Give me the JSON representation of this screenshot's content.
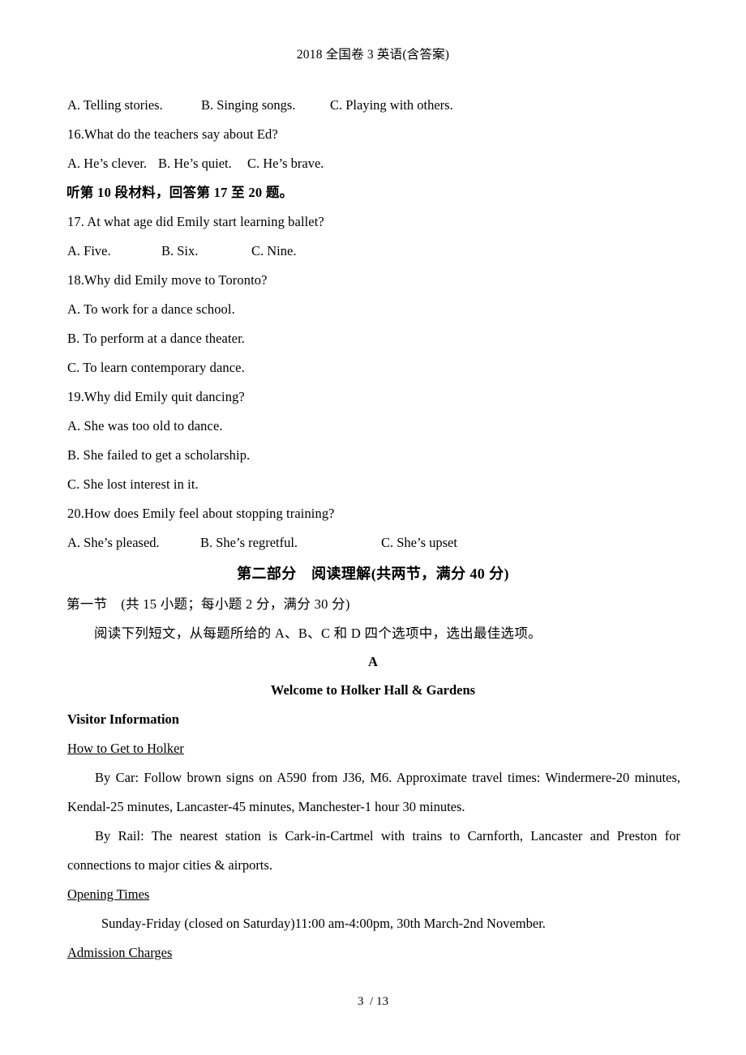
{
  "document": {
    "header_title": "2018 全国卷 3 英语(含答案)",
    "footer": "3  / 13"
  },
  "listening": {
    "q15_choices": {
      "a": "A. Telling stories.",
      "b": "B. Singing songs.",
      "c": "C. Playing with others."
    },
    "q16": {
      "stem": "16.What do the teachers say about Ed?",
      "a": "A. He’s clever.",
      "b": "B. He’s quiet.",
      "c": "C. He’s brave."
    },
    "material_note": "听第 10 段材料，回答第 17 至 20 题。",
    "q17": {
      "stem": "17. At what age did Emily start learning ballet?",
      "a": "A. Five.",
      "b": "B. Six.",
      "c": "C. Nine."
    },
    "q18": {
      "stem": "18.Why did Emily move to Toronto?",
      "a": "A. To work for a dance school.",
      "b": "B. To perform at a dance theater.",
      "c": "C. To learn contemporary dance."
    },
    "q19": {
      "stem": "19.Why did Emily quit dancing?",
      "a": "A. She was too old to dance.",
      "b": "B. She failed to get a scholarship.",
      "c": "C. She lost interest in it."
    },
    "q20": {
      "stem": "20.How does Emily feel about stopping training?",
      "a": "A. She’s pleased.",
      "b": "B. She’s regretful.",
      "c": "C. She’s upset"
    }
  },
  "part_two": {
    "heading": "第二部分　阅读理解(共两节，满分 40 分)",
    "section_one": "第一节　(共 15 小题；每小题 2 分，满分 30 分)",
    "instruction": "阅读下列短文，从每题所给的 A、B、C 和 D 四个选项中，选出最佳选项。"
  },
  "passage_a": {
    "letter": "A",
    "title": "Welcome to Holker Hall & Gardens",
    "visitor_information": "Visitor Information",
    "how_to_get_heading": "How to Get to Holker",
    "by_car": "By Car: Follow brown signs on A590 from J36, M6. Approximate travel times: Windermere-20 minutes, Kendal-25 minutes, Lancaster-45 minutes, Manchester-1 hour 30 minutes.",
    "by_rail": "By Rail: The nearest station is Cark-in-Cartmel with trains to Carnforth, Lancaster and Preston for connections to major cities & airports.",
    "opening_times_heading": "Opening Times",
    "opening_times_text": "Sunday-Friday (closed on Saturday)11:00 am-4:00pm, 30th March-2nd November.",
    "admission_charges_heading": "Admission Charges"
  }
}
